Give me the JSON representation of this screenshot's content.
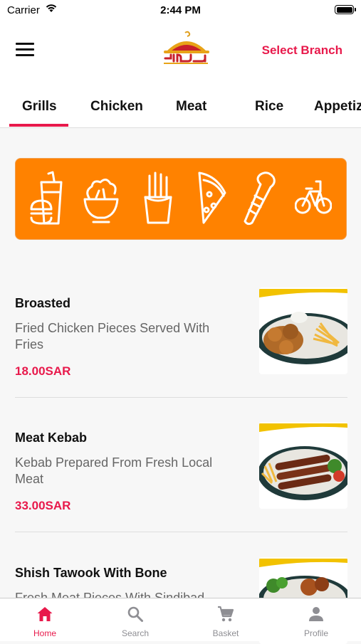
{
  "status_bar": {
    "carrier": "Carrier",
    "time": "2:44 PM"
  },
  "header": {
    "select_branch": "Select Branch"
  },
  "tabs": [
    {
      "label": "Grills"
    },
    {
      "label": "Chicken"
    },
    {
      "label": "Meat"
    },
    {
      "label": "Rice"
    },
    {
      "label": "Appetiz"
    }
  ],
  "banner": {
    "icons": [
      "drink-cup-icon",
      "salad-bowl-icon",
      "fries-icon",
      "pizza-slice-icon",
      "wrap-icon",
      "bicycle-icon"
    ]
  },
  "menu_items": [
    {
      "title": "Broasted",
      "description": "Fried Chicken Pieces Served With Fries",
      "price": "18.00SAR"
    },
    {
      "title": "Meat Kebab",
      "description": "Kebab Prepared From Fresh Local Meat",
      "price": "33.00SAR"
    },
    {
      "title": "Shish Tawook With Bone",
      "description": "Fresh Meat Pieces With Sindibad",
      "price": ""
    }
  ],
  "tabbar": [
    {
      "label": "Home",
      "icon": "home-icon"
    },
    {
      "label": "Search",
      "icon": "search-icon"
    },
    {
      "label": "Basket",
      "icon": "cart-icon"
    },
    {
      "label": "Profile",
      "icon": "person-icon"
    }
  ],
  "colors": {
    "accent": "#e8194b",
    "banner": "#ff8200",
    "inactive": "#8e8e93"
  }
}
